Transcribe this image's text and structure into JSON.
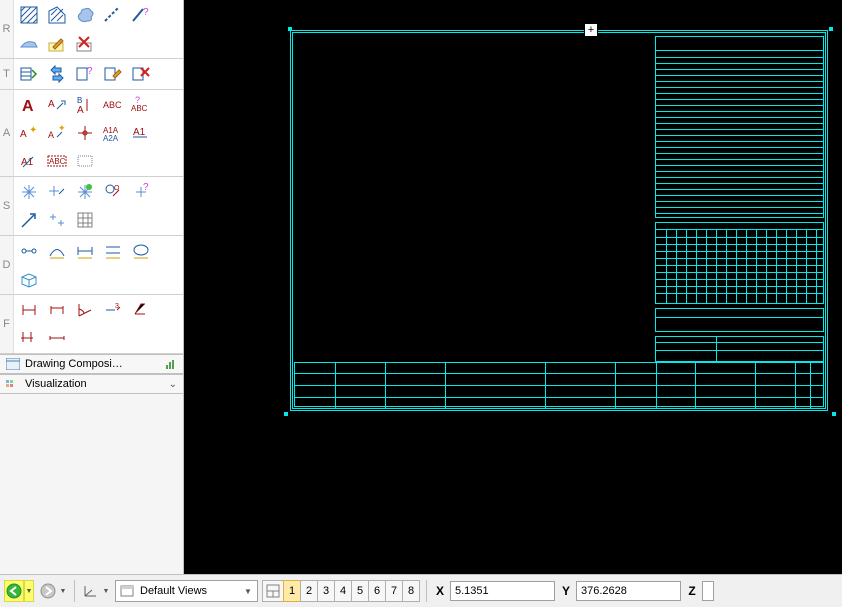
{
  "sidebar": {
    "rows": [
      {
        "label": "R"
      },
      {
        "label": "T"
      },
      {
        "label": "A"
      },
      {
        "label": "S"
      },
      {
        "label": "D"
      },
      {
        "label": "F"
      }
    ]
  },
  "panels": {
    "drawing_composition": "Drawing  Composi…",
    "visualization": "Visualization"
  },
  "statusbar": {
    "views_dropdown": "Default Views",
    "viewport_buttons": [
      "1",
      "2",
      "3",
      "4",
      "5",
      "6",
      "7",
      "8"
    ],
    "active_viewport": "1",
    "coords": {
      "x_label": "X",
      "x_value": "5.1351",
      "y_label": "Y",
      "y_value": "376.2628",
      "z_label": "Z",
      "z_value": ""
    }
  },
  "chart_data": null
}
